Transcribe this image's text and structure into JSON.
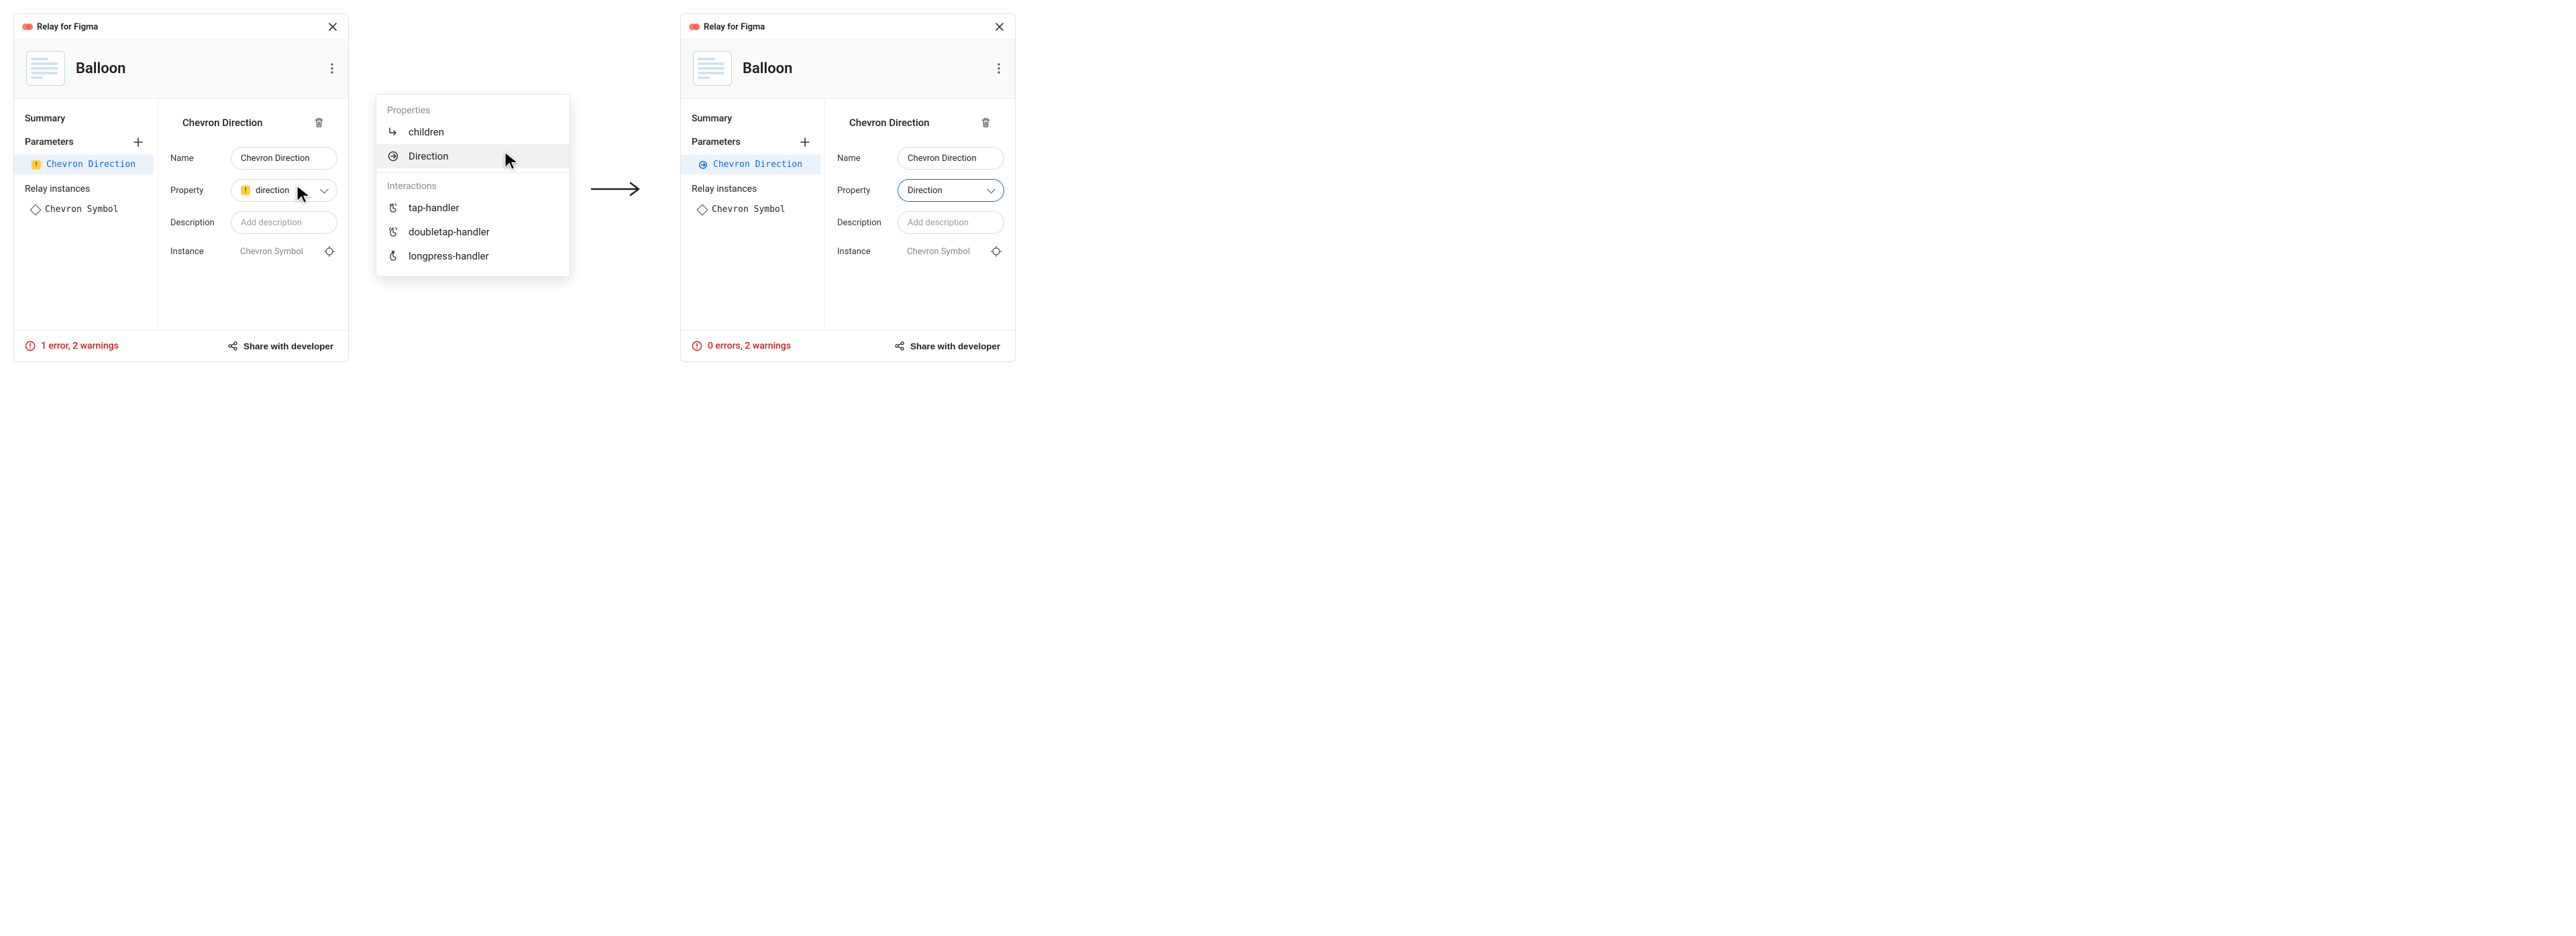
{
  "app_title": "Relay for Figma",
  "page_title": "Balloon",
  "sidebar": {
    "summary_label": "Summary",
    "parameters_label": "Parameters",
    "instances_label": "Relay instances",
    "selected_param_left": "Chevron Direction",
    "selected_param_right": "Chevron Direction",
    "instance_item": "Chevron Symbol"
  },
  "form": {
    "section_title": "Chevron Direction",
    "name_label": "Name",
    "name_value": "Chevron Direction",
    "property_label": "Property",
    "property_value_left": "direction",
    "property_value_right": "Direction",
    "description_label": "Description",
    "description_placeholder": "Add description",
    "instance_label": "Instance",
    "instance_value": "Chevron Symbol"
  },
  "popup": {
    "group_properties": "Properties",
    "group_interactions": "Interactions",
    "items_properties": [
      "children",
      "Direction"
    ],
    "items_interactions": [
      "tap-handler",
      "doubletap-handler",
      "longpress-handler"
    ]
  },
  "footer": {
    "status_left": "1 error, 2 warnings",
    "status_right": "0 errors, 2 warnings",
    "share_label": "Share with developer"
  }
}
